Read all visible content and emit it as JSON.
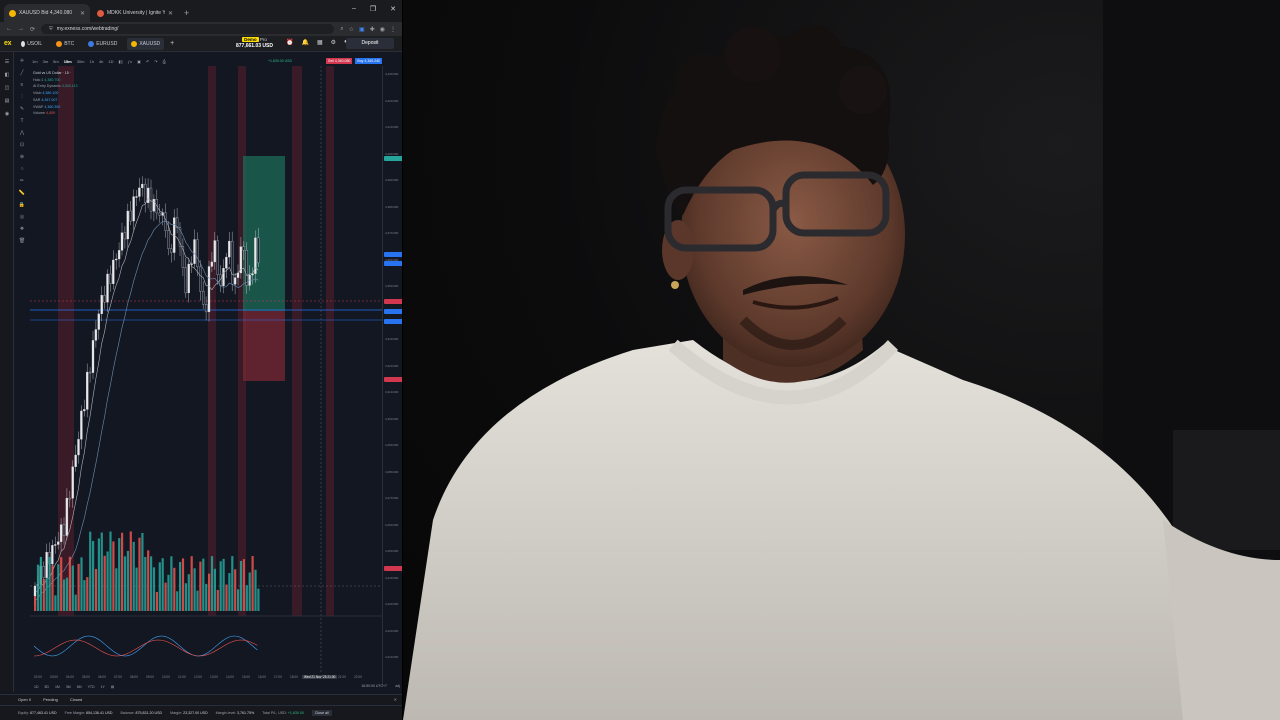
{
  "browser": {
    "tabs": [
      {
        "title": "XAUUSD Bid 4,340.080",
        "favicon_color": "#f5b700",
        "active": true
      },
      {
        "title": "MDKK University | Ignite Your F",
        "favicon_color": "#e05b3d",
        "active": false
      }
    ],
    "new_tab_label": "+",
    "window_controls": [
      "–",
      "❐",
      "✕"
    ],
    "url": "my.exness.com/webtrading/",
    "nav_icons": [
      "←",
      "→",
      "⟳",
      "⛨"
    ]
  },
  "app": {
    "logo": "ex",
    "instrument_tabs": [
      {
        "label": "USOIL",
        "icon_color": "#e0e0e0"
      },
      {
        "label": "BTC",
        "icon_color": "#f7931a"
      },
      {
        "label": "EURUSD",
        "icon_color": "#3f7ae0"
      },
      {
        "label": "XAUUSD",
        "icon_color": "#f5b700"
      }
    ],
    "add_tab": "+",
    "account_badge": "Demo",
    "account_type": "Pro",
    "balance": "877,661.03 USD",
    "deposit_label": "Deposit"
  },
  "chart": {
    "symbol_line": "Gold vs US Dollar · 15 ·",
    "indicators": [
      {
        "name": "Holo 1",
        "value": "4,380.700"
      },
      {
        "name": "AI Entry Dynamic",
        "value": "4,333.113"
      },
      {
        "name": "Vdub",
        "value": "4,380.100"
      },
      {
        "name": "SAR",
        "value": "4,367.007"
      },
      {
        "name": "VWAP",
        "value": "4,360.392"
      },
      {
        "name": "Volume",
        "value": "4,409"
      }
    ],
    "timeframes": [
      "1m",
      "3m",
      "5m",
      "15m",
      "30m",
      "1h",
      "4h",
      "1D"
    ],
    "active_timeframe": "15m",
    "sell_button": "Sell 4,340.080",
    "buy_button": "Buy 4,340.240",
    "position_pnl": "+1,630.00 USD",
    "price_labels": [
      "4,430.000",
      "4,420.000",
      "4,410.000",
      "4,400.000",
      "4,390.000",
      "4,380.000",
      "4,370.000",
      "4,360.000",
      "4,350.000",
      "4,340.000",
      "4,330.000",
      "4,320.000",
      "4,310.000",
      "4,300.000",
      "4,290.000",
      "4,280.000",
      "4,270.000",
      "4,260.000",
      "4,250.000",
      "4,240.000",
      "4,230.000",
      "4,220.000",
      "4,210.000"
    ],
    "time_labels": [
      "02:00",
      "03:00",
      "04:00",
      "05:00",
      "06:00",
      "07:00",
      "08:00",
      "09:00",
      "10:00",
      "11:00",
      "12:00",
      "13:00",
      "14:00",
      "15:00",
      "16:00",
      "17:00",
      "18:00",
      "19:00",
      "20:00",
      "21:00",
      "22:00"
    ],
    "cursor_time": "Wed 21 Nov '25  21:00",
    "ranges": [
      "1D",
      "5D",
      "1M",
      "3M",
      "6M",
      "YTD",
      "1Y"
    ],
    "timezone": "16:50:00 UTC+7",
    "adjust_label": "adj"
  },
  "orders": {
    "tabs": [
      "Open 0",
      "Pending",
      "Closed"
    ],
    "close_icon": "✕"
  },
  "footer": {
    "equity_label": "Equity:",
    "equity": "877,463.41 USD",
    "free_margin_label": "Free Margin:",
    "free_margin": "854,136.41 USD",
    "balance_label": "Balance:",
    "balance": "875,831.20 USD",
    "margin_label": "Margin:",
    "margin": "23,327.00 USD",
    "margin_level_label": "Margin level:",
    "margin_level": "3,761.75%",
    "total_pl_label": "Total P/L, USD:",
    "total_pl": "+1,630.00",
    "close_all_label": "Close all"
  },
  "colors": {
    "bull": "#26a69a",
    "bear": "#ef5350",
    "accent": "#ffde02",
    "buy": "#2874f0",
    "sell": "#d1374e"
  }
}
